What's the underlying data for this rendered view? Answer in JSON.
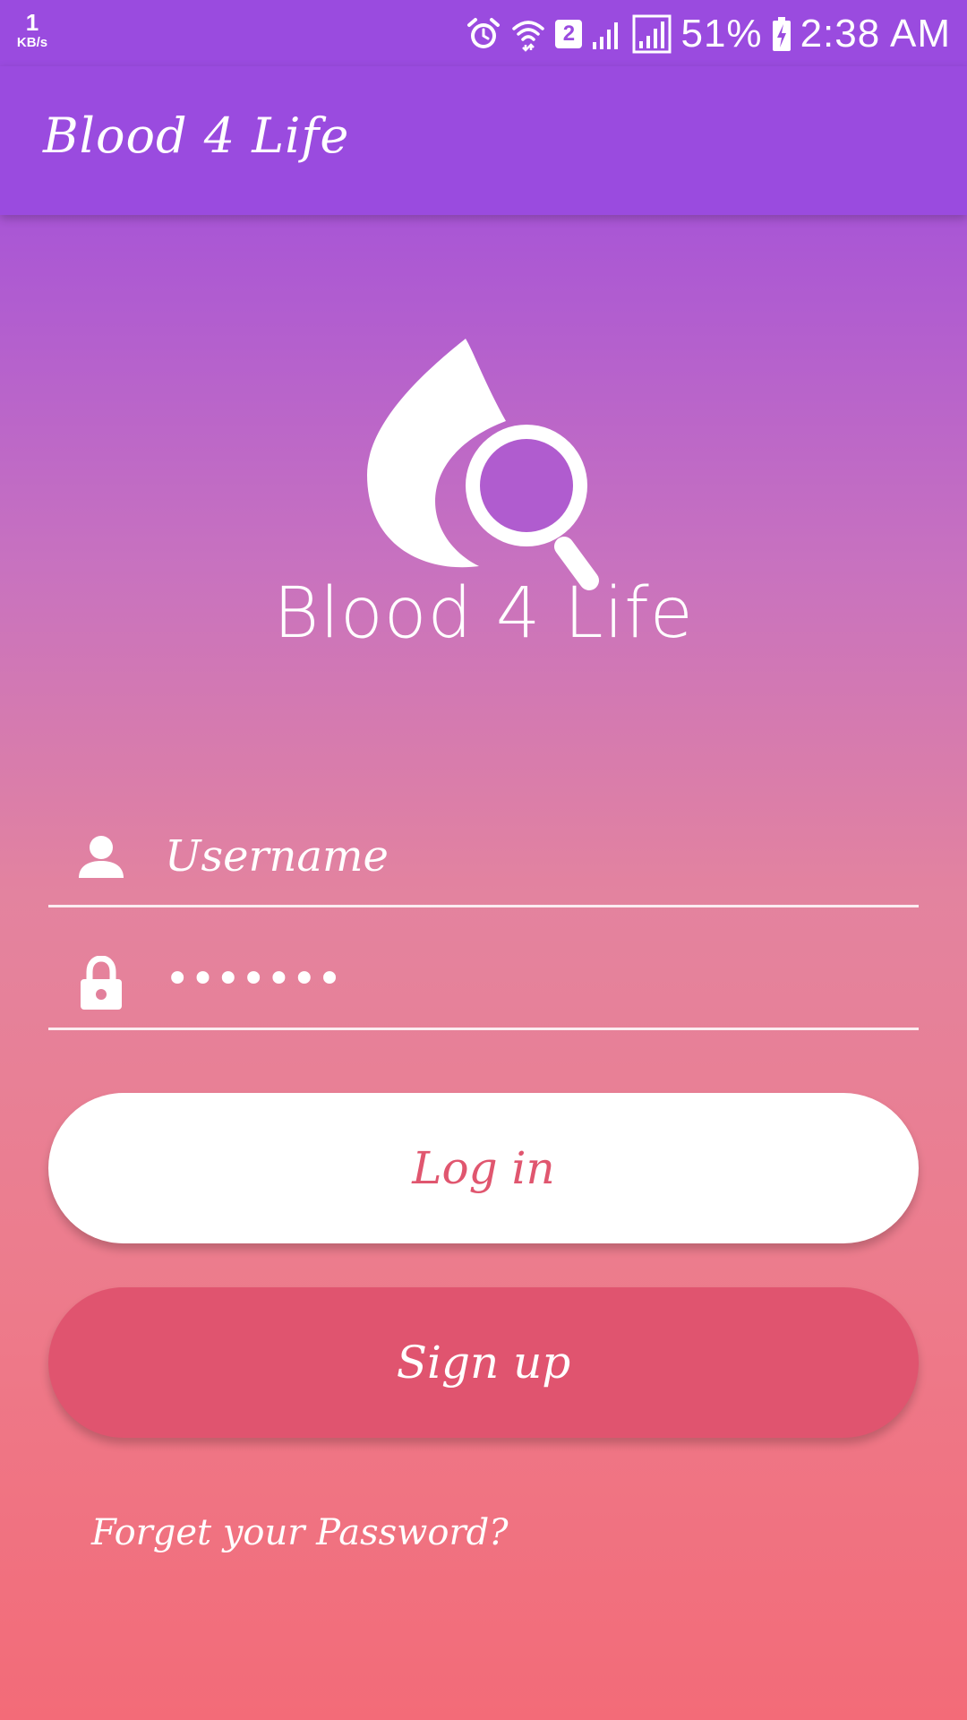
{
  "status_bar": {
    "net_speed": "1",
    "net_speed_unit": "KB/s",
    "sim_slot": "2",
    "battery": "51%",
    "time": "2:38 AM"
  },
  "app_bar": {
    "title": "Blood 4 Life"
  },
  "logo": {
    "text": "Blood 4 Life"
  },
  "form": {
    "username_placeholder": "Username",
    "username_value": "",
    "password_value": "•••••••"
  },
  "buttons": {
    "login_label": "Log in",
    "signup_label": "Sign up"
  },
  "links": {
    "forgot_password": "Forget your Password?"
  },
  "colors": {
    "app_bar": "#9a4bdf",
    "gradient_top": "#9c4de0",
    "gradient_bottom": "#f36b78",
    "login_text": "#e0566f",
    "signup_bg": "#e0546f"
  },
  "icons": {
    "username": "person-icon",
    "password": "lock-icon",
    "logo": "blood-drop-search-icon"
  }
}
